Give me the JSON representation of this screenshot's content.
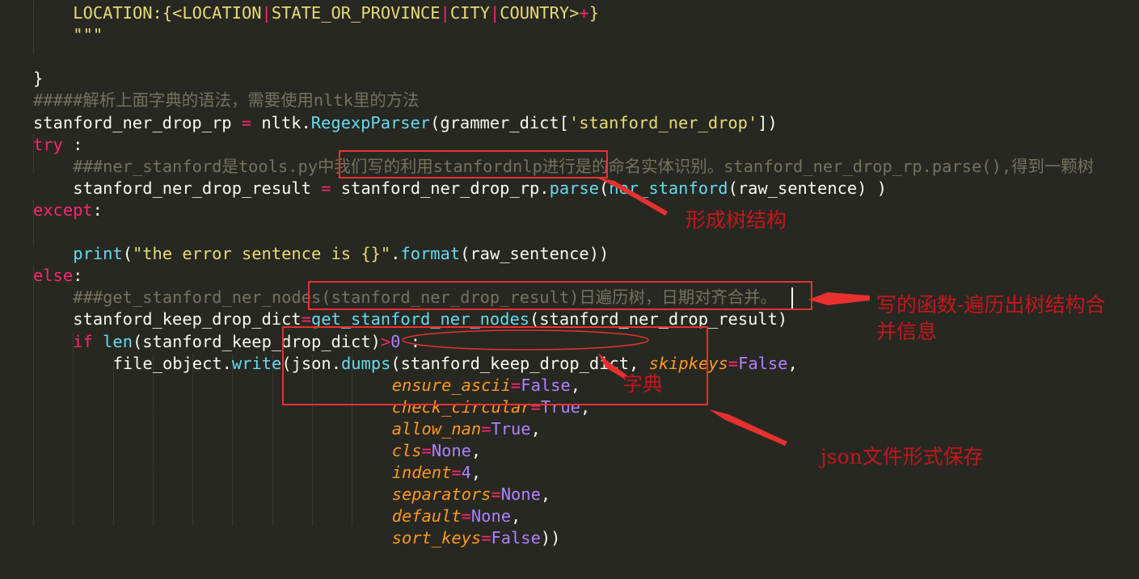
{
  "code_lines": [
    {
      "indent": 1,
      "tokens": [
        {
          "t": "LOCATION:{<LOCATION",
          "c": "st"
        },
        {
          "t": "|",
          "c": "op"
        },
        {
          "t": "STATE_OR_PROVINCE",
          "c": "st"
        },
        {
          "t": "|",
          "c": "op"
        },
        {
          "t": "CITY",
          "c": "st"
        },
        {
          "t": "|",
          "c": "op"
        },
        {
          "t": "COUNTRY>",
          "c": "st"
        },
        {
          "t": "+",
          "c": "op"
        },
        {
          "t": "}",
          "c": "st"
        }
      ]
    },
    {
      "indent": 1,
      "tokens": [
        {
          "t": "\"\"\"",
          "c": "st"
        }
      ]
    },
    {
      "indent": 0,
      "tokens": []
    },
    {
      "indent": 0,
      "tokens": [
        {
          "t": "}",
          "c": "pl"
        }
      ]
    },
    {
      "indent": 0,
      "tokens": [
        {
          "t": "#####解析上面字典的语法，需要使用nltk里的方法",
          "c": "cm"
        }
      ]
    },
    {
      "indent": 0,
      "tokens": [
        {
          "t": "stanford_ner_drop_rp ",
          "c": "pl"
        },
        {
          "t": "=",
          "c": "op"
        },
        {
          "t": " nltk.",
          "c": "pl"
        },
        {
          "t": "RegexpParser",
          "c": "fn"
        },
        {
          "t": "(grammer_dict[",
          "c": "pl"
        },
        {
          "t": "'stanford_ner_drop'",
          "c": "st"
        },
        {
          "t": "])",
          "c": "pl"
        }
      ]
    },
    {
      "indent": 0,
      "tokens": [
        {
          "t": "try",
          "c": "kw"
        },
        {
          "t": " :",
          "c": "pl"
        }
      ]
    },
    {
      "indent": 1,
      "tokens": [
        {
          "t": "###ner_stanford是tools.py中我们写的利用stanfordnlp进行是的命名实体识别。stanford_ner_drop_rp.parse(),得到一颗树",
          "c": "cm"
        }
      ]
    },
    {
      "indent": 1,
      "tokens": [
        {
          "t": "stanford_ner_drop_result ",
          "c": "pl"
        },
        {
          "t": "=",
          "c": "op"
        },
        {
          "t": " stanford_ner_drop_rp.",
          "c": "pl"
        },
        {
          "t": "parse",
          "c": "fn"
        },
        {
          "t": "(",
          "c": "pl"
        },
        {
          "t": "ner_stanford",
          "c": "fn"
        },
        {
          "t": "(raw_sentence) )",
          "c": "pl"
        }
      ]
    },
    {
      "indent": 0,
      "tokens": [
        {
          "t": "except",
          "c": "kw"
        },
        {
          "t": ":",
          "c": "pl"
        }
      ]
    },
    {
      "indent": 0,
      "tokens": []
    },
    {
      "indent": 1,
      "tokens": [
        {
          "t": "print",
          "c": "fn"
        },
        {
          "t": "(",
          "c": "pl"
        },
        {
          "t": "\"the error sentence is {}\"",
          "c": "st"
        },
        {
          "t": ".",
          "c": "pl"
        },
        {
          "t": "format",
          "c": "fn"
        },
        {
          "t": "(raw_sentence))",
          "c": "pl"
        }
      ]
    },
    {
      "indent": 0,
      "tokens": [
        {
          "t": "else",
          "c": "kw"
        },
        {
          "t": ":",
          "c": "pl"
        }
      ]
    },
    {
      "indent": 1,
      "tokens": [
        {
          "t": "###get_stanford_ner_nodes(stanford_ner_drop_result)日遍历树，日期对齐合并。",
          "c": "cm"
        }
      ]
    },
    {
      "indent": 1,
      "tokens": [
        {
          "t": "stanford_keep_drop_dict",
          "c": "pl"
        },
        {
          "t": "=",
          "c": "op"
        },
        {
          "t": "get_stanford_ner_nodes",
          "c": "fn"
        },
        {
          "t": "(stanford_ner_drop_result)",
          "c": "pl"
        }
      ]
    },
    {
      "indent": 1,
      "tokens": [
        {
          "t": "if",
          "c": "kw"
        },
        {
          "t": " ",
          "c": "pl"
        },
        {
          "t": "len",
          "c": "fn"
        },
        {
          "t": "(stanford_keep_drop_dict)",
          "c": "pl"
        },
        {
          "t": ">",
          "c": "op"
        },
        {
          "t": "0",
          "c": "nm"
        },
        {
          "t": " :",
          "c": "pl"
        }
      ]
    },
    {
      "indent": 2,
      "tokens": [
        {
          "t": "file_object.",
          "c": "pl"
        },
        {
          "t": "write",
          "c": "fn"
        },
        {
          "t": "(json.",
          "c": "pl"
        },
        {
          "t": "dumps",
          "c": "fn"
        },
        {
          "t": "(stanford_keep_drop_dict, ",
          "c": "pl"
        },
        {
          "t": "skipkeys",
          "c": "pa"
        },
        {
          "t": "=",
          "c": "op"
        },
        {
          "t": "False",
          "c": "nm"
        },
        {
          "t": ",",
          "c": "pl"
        }
      ]
    },
    {
      "indent": 9,
      "tokens": [
        {
          "t": "ensure_ascii",
          "c": "pa"
        },
        {
          "t": "=",
          "c": "op"
        },
        {
          "t": "False",
          "c": "nm"
        },
        {
          "t": ",",
          "c": "pl"
        }
      ]
    },
    {
      "indent": 9,
      "tokens": [
        {
          "t": "check_circular",
          "c": "pa"
        },
        {
          "t": "=",
          "c": "op"
        },
        {
          "t": "True",
          "c": "nm"
        },
        {
          "t": ",",
          "c": "pl"
        }
      ]
    },
    {
      "indent": 9,
      "tokens": [
        {
          "t": "allow_nan",
          "c": "pa"
        },
        {
          "t": "=",
          "c": "op"
        },
        {
          "t": "True",
          "c": "nm"
        },
        {
          "t": ",",
          "c": "pl"
        }
      ]
    },
    {
      "indent": 9,
      "tokens": [
        {
          "t": "cls",
          "c": "pa"
        },
        {
          "t": "=",
          "c": "op"
        },
        {
          "t": "None",
          "c": "nm"
        },
        {
          "t": ",",
          "c": "pl"
        }
      ]
    },
    {
      "indent": 9,
      "tokens": [
        {
          "t": "indent",
          "c": "pa"
        },
        {
          "t": "=",
          "c": "op"
        },
        {
          "t": "4",
          "c": "nm"
        },
        {
          "t": ",",
          "c": "pl"
        }
      ]
    },
    {
      "indent": 9,
      "tokens": [
        {
          "t": "separators",
          "c": "pa"
        },
        {
          "t": "=",
          "c": "op"
        },
        {
          "t": "None",
          "c": "nm"
        },
        {
          "t": ",",
          "c": "pl"
        }
      ]
    },
    {
      "indent": 9,
      "tokens": [
        {
          "t": "default",
          "c": "pa"
        },
        {
          "t": "=",
          "c": "op"
        },
        {
          "t": "None",
          "c": "nm"
        },
        {
          "t": ",",
          "c": "pl"
        }
      ]
    },
    {
      "indent": 9,
      "tokens": [
        {
          "t": "sort_keys",
          "c": "pa"
        },
        {
          "t": "=",
          "c": "op"
        },
        {
          "t": "False",
          "c": "nm"
        },
        {
          "t": "))",
          "c": "pl"
        }
      ]
    }
  ],
  "annotations": {
    "tree_structure": "形成树结构",
    "function_note_line1": "写的函数-遍历出树结构合",
    "function_note_line2": "并信息",
    "dict_note": "字典",
    "json_note": "json文件形式保存"
  },
  "colors": {
    "background": "#272822",
    "annotation_red": "#e8312f"
  }
}
